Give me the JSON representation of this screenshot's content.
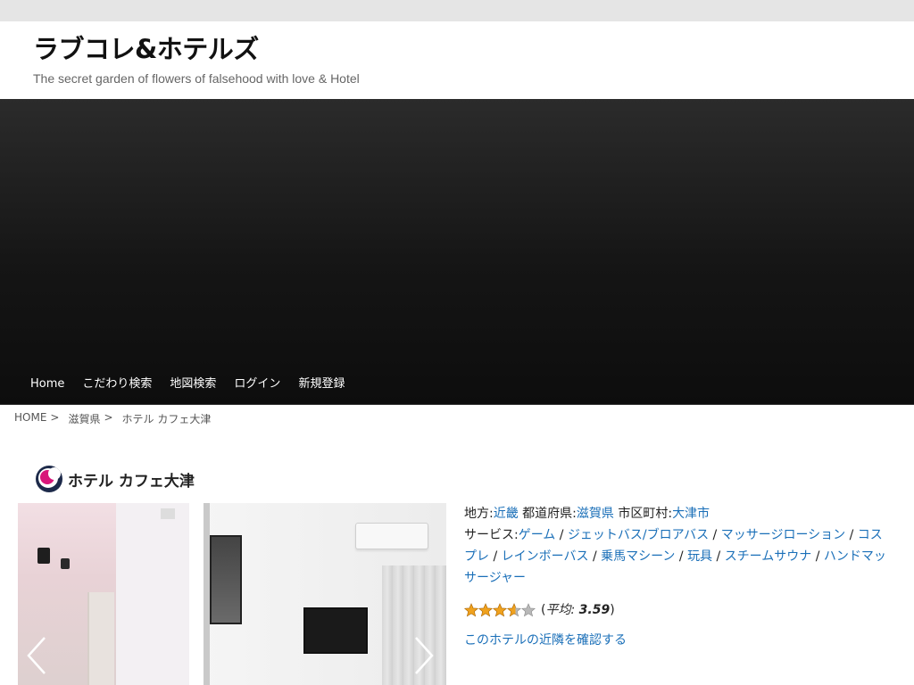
{
  "site": {
    "title": "ラブコレ&ホテルズ",
    "tagline": "The secret garden of flowers of falsehood with love & Hotel"
  },
  "nav": {
    "items": [
      "Home",
      "こだわり検索",
      "地図検索",
      "ログイン",
      "新規登録"
    ]
  },
  "breadcrumb": {
    "items": [
      "HOME",
      "滋賀県",
      "ホテル カフェ大津"
    ],
    "separator": ">"
  },
  "page": {
    "title": "ホテル カフェ大津"
  },
  "hotel": {
    "region_label": "地方:",
    "region": "近畿",
    "prefecture_label": "都道府県:",
    "prefecture": "滋賀県",
    "city_label": "市区町村:",
    "city": "大津市",
    "services_label": "サービス:",
    "services": [
      "ゲーム",
      "ジェットバス/ブロアバス",
      "マッサージローション",
      "コスプレ",
      "レインボーバス",
      "乗馬マシーン",
      "玩具",
      "スチームサウナ",
      "ハンドマッサージャー"
    ],
    "service_separator": "/",
    "rating": {
      "value": 3.59,
      "max": 5,
      "label_prefix": "(",
      "label_avg": "平均:",
      "label_value": "3.59",
      "label_suffix": ")"
    },
    "neighbors_link": "このホテルの近隣を確認する"
  },
  "colors": {
    "link": "#1a6fb8",
    "star_fill": "#f0a21e",
    "star_empty": "#b8b8b8"
  },
  "icons": {
    "prev": "chevron-left-icon",
    "next": "chevron-right-icon",
    "title_logo": "brand-logo-icon",
    "star": "star-icon"
  }
}
